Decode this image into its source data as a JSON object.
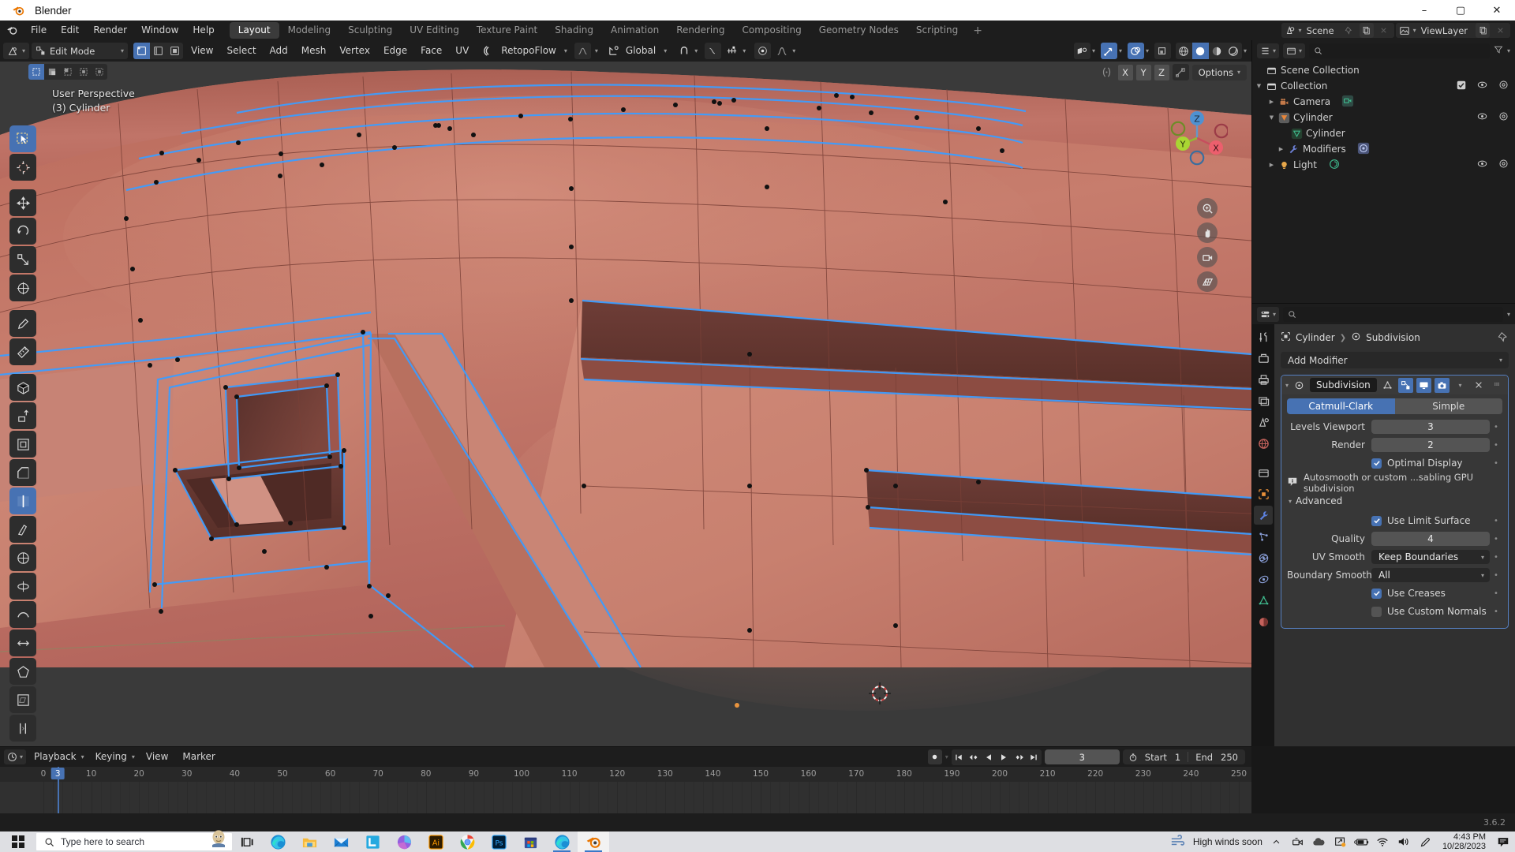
{
  "window": {
    "title": "Blender",
    "minimize": "–",
    "maximize": "▢",
    "close": "✕"
  },
  "topbar": {
    "menus": [
      "File",
      "Edit",
      "Render",
      "Window",
      "Help"
    ],
    "workspaces": [
      "Layout",
      "Modeling",
      "Sculpting",
      "UV Editing",
      "Texture Paint",
      "Shading",
      "Animation",
      "Rendering",
      "Compositing",
      "Geometry Nodes",
      "Scripting"
    ],
    "active_workspace": "Layout",
    "add_workspace": "+",
    "scene_name": "Scene",
    "viewlayer_name": "ViewLayer"
  },
  "viewport": {
    "mode": "Edit Mode",
    "menus": [
      "View",
      "Select",
      "Add",
      "Mesh",
      "Vertex",
      "Edge",
      "Face",
      "UV"
    ],
    "retopoflow": "RetopoFlow",
    "transform_orientation": "Global",
    "perspective_label": "User Perspective",
    "object_label": "(3) Cylinder",
    "axis_buttons": [
      "X",
      "Y",
      "Z"
    ],
    "options_label": "Options",
    "gizmo_axes": {
      "x": "X",
      "y": "Y",
      "z": "Z"
    },
    "select_modes": [
      "vertex-select",
      "edge-select",
      "face-select"
    ],
    "tools": [
      "tweak-tool",
      "cursor-tool",
      "move-tool",
      "rotate-tool",
      "scale-tool",
      "transform-tool",
      "annotate-tool",
      "measure-tool",
      "add-cube-tool",
      "extrude-tool",
      "inset-faces-tool",
      "bevel-tool",
      "loop-cut-tool",
      "knife-tool",
      "poly-build-tool",
      "spin-tool",
      "smooth-tool",
      "edge-slide-tool",
      "shrink-fatten-tool",
      "shear-tool",
      "rip-region-tool"
    ],
    "colors": {
      "mesh_base": "#c4796a",
      "edge_select": "#3d9dff",
      "gizmo_x": "#ec5f6d",
      "gizmo_y": "#a9d633",
      "gizmo_z": "#4f91d1"
    }
  },
  "outliner": {
    "display_mode": "view-layer",
    "search_placeholder": "",
    "rows": [
      {
        "name": "Scene Collection",
        "icon": "collection-icon",
        "depth": 0,
        "tri": "",
        "controls": []
      },
      {
        "name": "Collection",
        "icon": "collection-icon",
        "depth": 0,
        "tri": "▼",
        "controls": [
          "checkbox",
          "eye",
          "camera"
        ]
      },
      {
        "name": "Camera",
        "icon": "camera-object-icon",
        "depth": 1,
        "tri": "▶",
        "controls": [
          "eye",
          "camera"
        ],
        "data_icon": "camera-data-icon"
      },
      {
        "name": "Cylinder",
        "icon": "mesh-object-icon",
        "depth": 1,
        "tri": "▼",
        "controls": [
          "eye",
          "camera"
        ]
      },
      {
        "name": "Cylinder",
        "icon": "mesh-data-icon",
        "depth": 2,
        "tri": "",
        "controls": []
      },
      {
        "name": "Modifiers",
        "icon": "wrench-icon",
        "depth": 2,
        "tri": "▶",
        "controls": [],
        "data_icon": "subdivision-icon"
      },
      {
        "name": "Light",
        "icon": "light-object-icon",
        "depth": 1,
        "tri": "▶",
        "controls": [
          "eye",
          "camera"
        ],
        "data_icon": "light-data-icon"
      }
    ]
  },
  "properties": {
    "breadcrumb_object": "Cylinder",
    "breadcrumb_modifier": "Subdivision",
    "pin_icon": "pin-icon",
    "add_modifier": "Add Modifier",
    "tabs": [
      "tool-tab",
      "render-tab",
      "output-tab",
      "viewlayer-tab",
      "scene-tab",
      "world-tab",
      "collection-tab",
      "object-tab",
      "modifier-tab",
      "particles-tab",
      "physics-tab",
      "constraints-tab",
      "data-tab",
      "material-tab"
    ],
    "active_tab": "modifier-tab",
    "modifier": {
      "name": "Subdivision",
      "icon": "subdivision-icon",
      "header_toggles": [
        "on-cage",
        "edit-mode",
        "realtime",
        "render"
      ],
      "extras_icon": "chevron-down-icon",
      "close_icon": "x-icon",
      "drag_icon": "drag-dots-icon",
      "type_options": [
        "Catmull-Clark",
        "Simple"
      ],
      "type_selected": "Catmull-Clark",
      "fields": [
        {
          "label": "Levels Viewport",
          "value": "3",
          "kind": "number"
        },
        {
          "label": "Render",
          "value": "2",
          "kind": "number"
        }
      ],
      "optimal_display": {
        "label": "Optimal Display",
        "checked": true
      },
      "info_text": "Autosmooth or custom ...sabling GPU subdivision",
      "advanced_label": "Advanced",
      "advanced": {
        "use_limit_surface": {
          "label": "Use Limit Surface",
          "checked": true
        },
        "quality": {
          "label": "Quality",
          "value": "4"
        },
        "uv_smooth": {
          "label": "UV Smooth",
          "value": "Keep Boundaries"
        },
        "boundary_smooth": {
          "label": "Boundary Smooth",
          "value": "All"
        },
        "use_creases": {
          "label": "Use Creases",
          "checked": true
        },
        "use_custom_normals": {
          "label": "Use Custom Normals",
          "checked": false
        }
      }
    }
  },
  "timeline": {
    "menus": [
      "Playback",
      "Keying",
      "View",
      "Marker"
    ],
    "current_frame": "3",
    "start_label": "Start",
    "start_value": "1",
    "end_label": "End",
    "end_value": "250",
    "ticks": [
      0,
      10,
      20,
      30,
      40,
      50,
      60,
      70,
      80,
      90,
      100,
      110,
      120,
      130,
      140,
      150,
      160,
      170,
      180,
      190,
      200,
      210,
      220,
      230,
      240,
      250
    ],
    "playhead_frame": 3,
    "transport": [
      "jump-start",
      "jump-prev-keyframe",
      "play-reverse",
      "play",
      "jump-next-keyframe",
      "jump-end"
    ]
  },
  "statusbar": {
    "version": "3.6.2"
  },
  "taskbar": {
    "search_placeholder": "Type here to search",
    "apps": [
      "edge-icon",
      "file-explorer-icon",
      "mail-icon",
      "l-app-icon",
      "onedrive-icon",
      "illustrator-icon",
      "chrome-icon",
      "photoshop-icon",
      "microsoft-store-icon",
      "edge-icon-2",
      "blender-icon"
    ],
    "weather": "High winds soon",
    "time": "4:43 PM",
    "date": "10/28/2023"
  }
}
